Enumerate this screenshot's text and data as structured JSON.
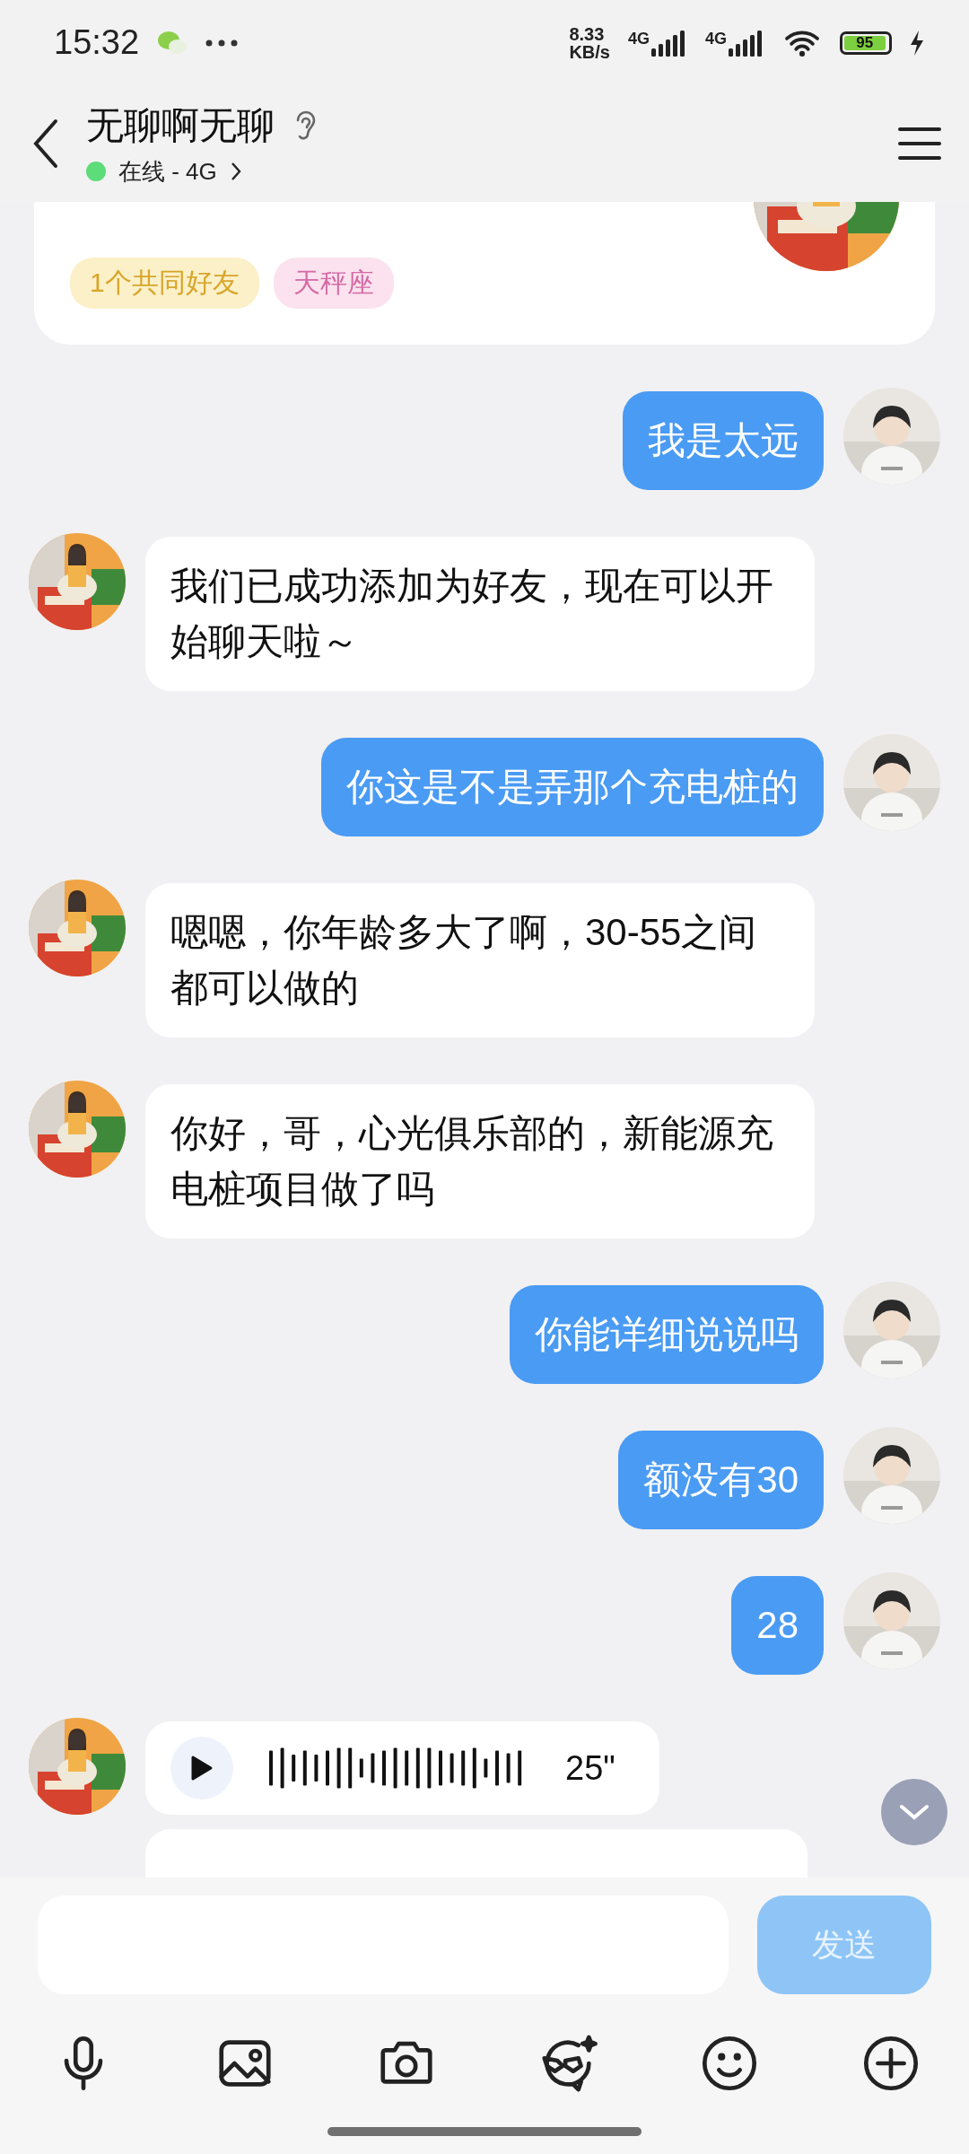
{
  "status_bar": {
    "time": "15:32",
    "net_speed": "8.33",
    "net_unit": "KB/s",
    "sim1": "4G",
    "sim2": "4G",
    "battery": "95",
    "charging": true
  },
  "header": {
    "name": "无聊啊无聊",
    "status": "在线 - 4G",
    "online": true
  },
  "profile_card": {
    "tags": [
      {
        "label": "1个共同好友",
        "kind": "friends"
      },
      {
        "label": "天秤座",
        "kind": "zodiac"
      }
    ]
  },
  "messages": [
    {
      "sent": true,
      "kind": "text",
      "text": "我是太远"
    },
    {
      "sent": false,
      "kind": "text",
      "text": "我们已成功添加为好友，现在可以开始聊天啦～"
    },
    {
      "sent": true,
      "kind": "text",
      "text": "你这是不是弄那个充电桩的"
    },
    {
      "sent": false,
      "kind": "text",
      "text": "嗯嗯，你年龄多大了啊，30-55之间都可以做的"
    },
    {
      "sent": false,
      "kind": "text",
      "text": "你好，哥，心光俱乐部的，新能源充电桩项目做了吗"
    },
    {
      "sent": true,
      "kind": "text",
      "text": "你能详细说说吗"
    },
    {
      "sent": true,
      "kind": "text",
      "text": "额没有30"
    },
    {
      "sent": true,
      "kind": "text",
      "text": "28"
    },
    {
      "sent": false,
      "kind": "voice",
      "duration": "25\""
    },
    {
      "sent": false,
      "kind": "cut"
    }
  ],
  "composer": {
    "send": "发送"
  }
}
